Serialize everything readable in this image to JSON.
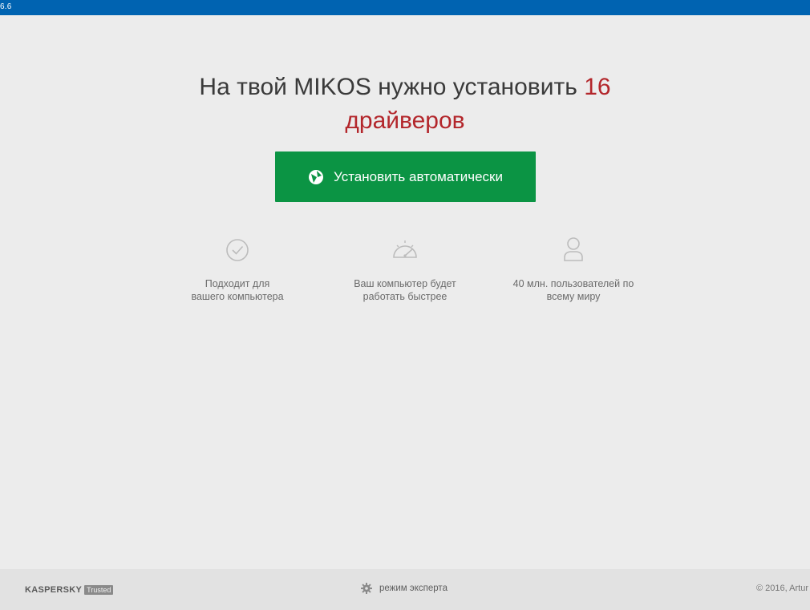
{
  "window": {
    "version_label": "6.6",
    "title_color": "#0063b1"
  },
  "headline": {
    "line1_prefix": "На твой MIKOS нужно установить ",
    "count": "16",
    "line2": "драйверов",
    "accent_color": "#b3262b"
  },
  "install_button": {
    "label": "Установить автоматически",
    "color": "#0b9444",
    "icon": "driverpack-ball-icon"
  },
  "features": [
    {
      "icon": "checkmark-circle-icon",
      "text_line1": "Подходит для",
      "text_line2": "вашего компьютера"
    },
    {
      "icon": "speedometer-icon",
      "text_line1": "Ваш компьютер будет",
      "text_line2": "работать быстрее"
    },
    {
      "icon": "user-icon",
      "text_line1": "40 млн. пользователей по",
      "text_line2": "всему миру"
    }
  ],
  "footer": {
    "kaspersky_name": "KASPERSKY",
    "kaspersky_badge": "Trusted",
    "expert_mode_label": "режим эксперта",
    "expert_mode_icon": "gear-icon",
    "copyright": "© 2016, Artur"
  }
}
